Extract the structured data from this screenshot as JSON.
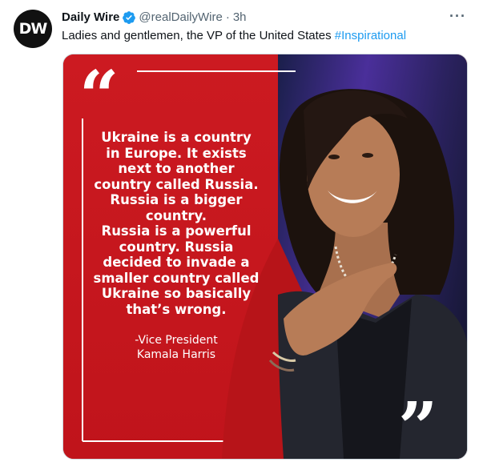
{
  "tweet": {
    "avatar_text": "DW",
    "display_name": "Daily Wire",
    "handle": "@realDailyWire",
    "separator": "·",
    "time": "3h",
    "more_label": "···",
    "text": "Ladies and gentlemen, the VP of the United States ",
    "hashtag": "#Inspirational"
  },
  "media": {
    "open_quote": "“",
    "close_quote": "”",
    "quote_lines": [
      "Ukraine is a country",
      "in Europe. It exists",
      "next to another",
      "country called Russia.",
      "Russia is a bigger",
      "country.",
      "Russia is a powerful",
      "country. Russia",
      "decided to invade a",
      "smaller country called",
      "Ukraine so basically",
      "that’s wrong."
    ],
    "attribution_lines": [
      "-Vice President",
      "Kamala Harris"
    ]
  },
  "colors": {
    "accent": "#1d9bf0",
    "quote_red": "#c4161c",
    "text_primary": "#0f1419",
    "text_secondary": "#536471"
  },
  "icons": {
    "verified": "verified-badge-icon",
    "more": "more-options-icon"
  }
}
